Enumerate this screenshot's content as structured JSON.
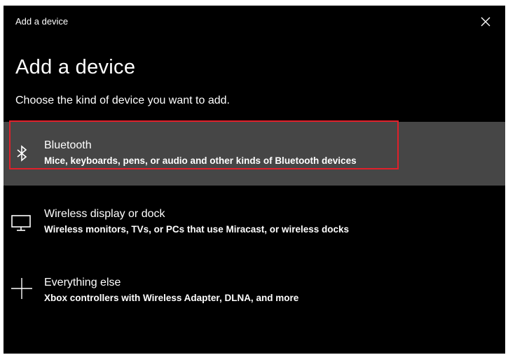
{
  "window": {
    "title": "Add a device",
    "close_icon": "close-icon"
  },
  "page": {
    "heading": "Add a device",
    "subheading": "Choose the kind of device you want to add."
  },
  "options": [
    {
      "icon": "bluetooth-icon",
      "title": "Bluetooth",
      "description": "Mice, keyboards, pens, or audio and other kinds of Bluetooth devices",
      "selected": true
    },
    {
      "icon": "monitor-icon",
      "title": "Wireless display or dock",
      "description": "Wireless monitors, TVs, or PCs that use Miracast, or wireless docks",
      "selected": false
    },
    {
      "icon": "plus-icon",
      "title": "Everything else",
      "description": "Xbox controllers with Wireless Adapter, DLNA, and more",
      "selected": false
    }
  ],
  "colors": {
    "background": "#000000",
    "selected_row": "#464646",
    "highlight_border": "#e0202a",
    "text": "#ffffff"
  }
}
